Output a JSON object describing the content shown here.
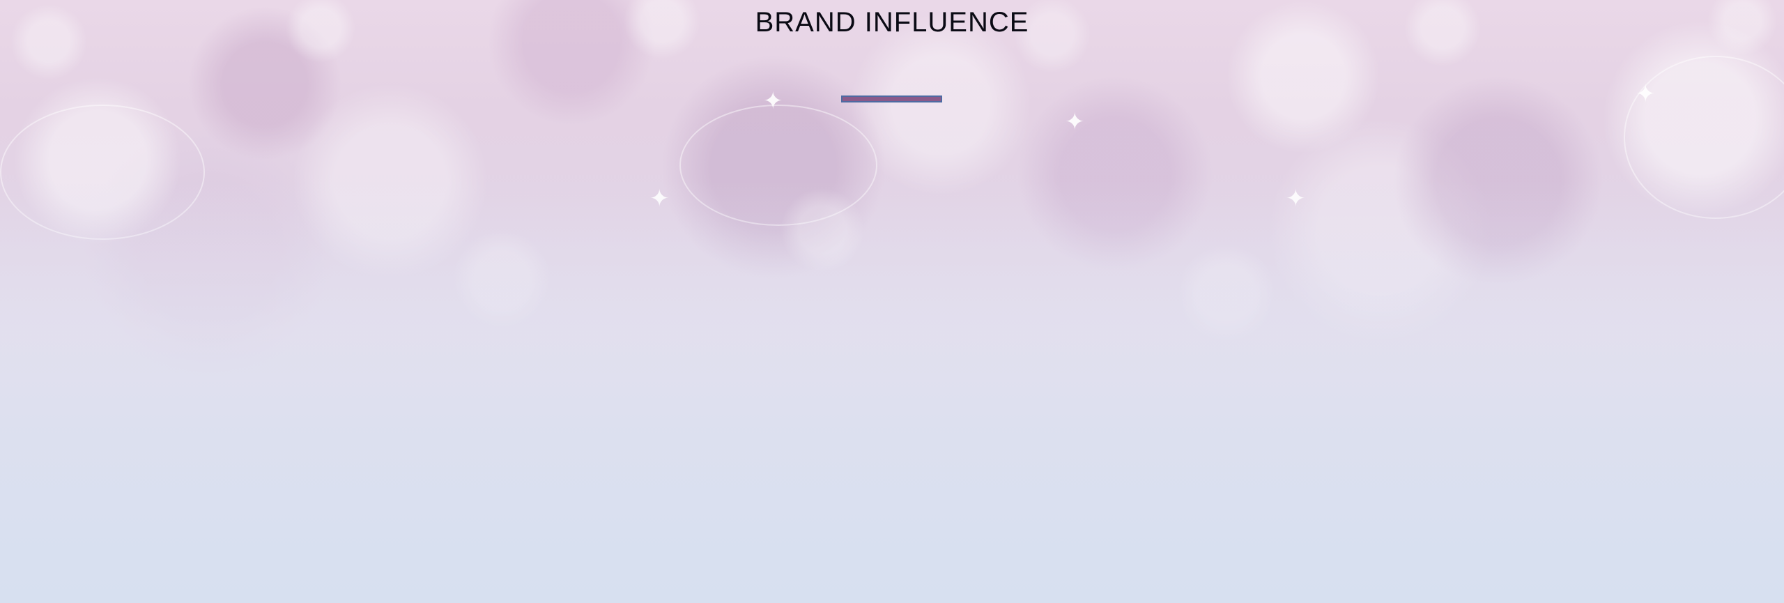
{
  "slide": {
    "title": "BRAND INFLUENCE",
    "accent_color": "#8a5a8a",
    "accent_border_color": "#4e6aa2",
    "background": "pink-to-blue crystal bokeh photo"
  }
}
